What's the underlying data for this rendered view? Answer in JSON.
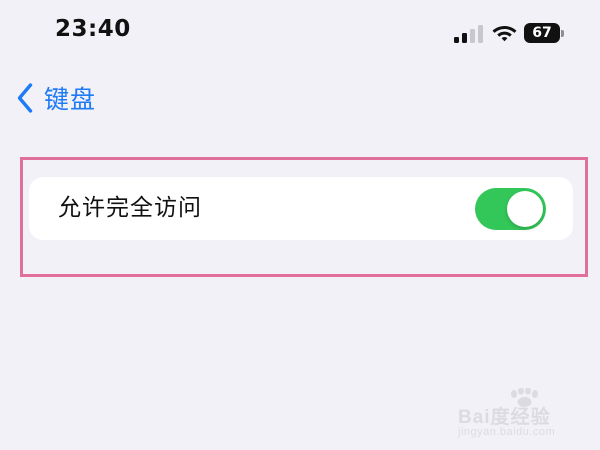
{
  "status_bar": {
    "time": "23:40",
    "battery_level": "67",
    "signal_bars_filled": 2,
    "signal_bars_total": 4
  },
  "navigation": {
    "back_label": "键盘"
  },
  "settings": {
    "rows": [
      {
        "label": "允许完全访问",
        "toggle_on": true
      }
    ]
  },
  "watermark": {
    "text": "Bai度经验",
    "url": "jingyan.baidu.com"
  },
  "colors": {
    "background": "#f2f1f7",
    "accent_blue": "#1e7bf5",
    "toggle_green": "#33c759",
    "highlight_pink": "#e0709a"
  },
  "icons": {
    "back": "chevron-left-icon",
    "signal": "cellular-signal-icon",
    "wifi": "wifi-icon",
    "battery": "battery-icon"
  }
}
